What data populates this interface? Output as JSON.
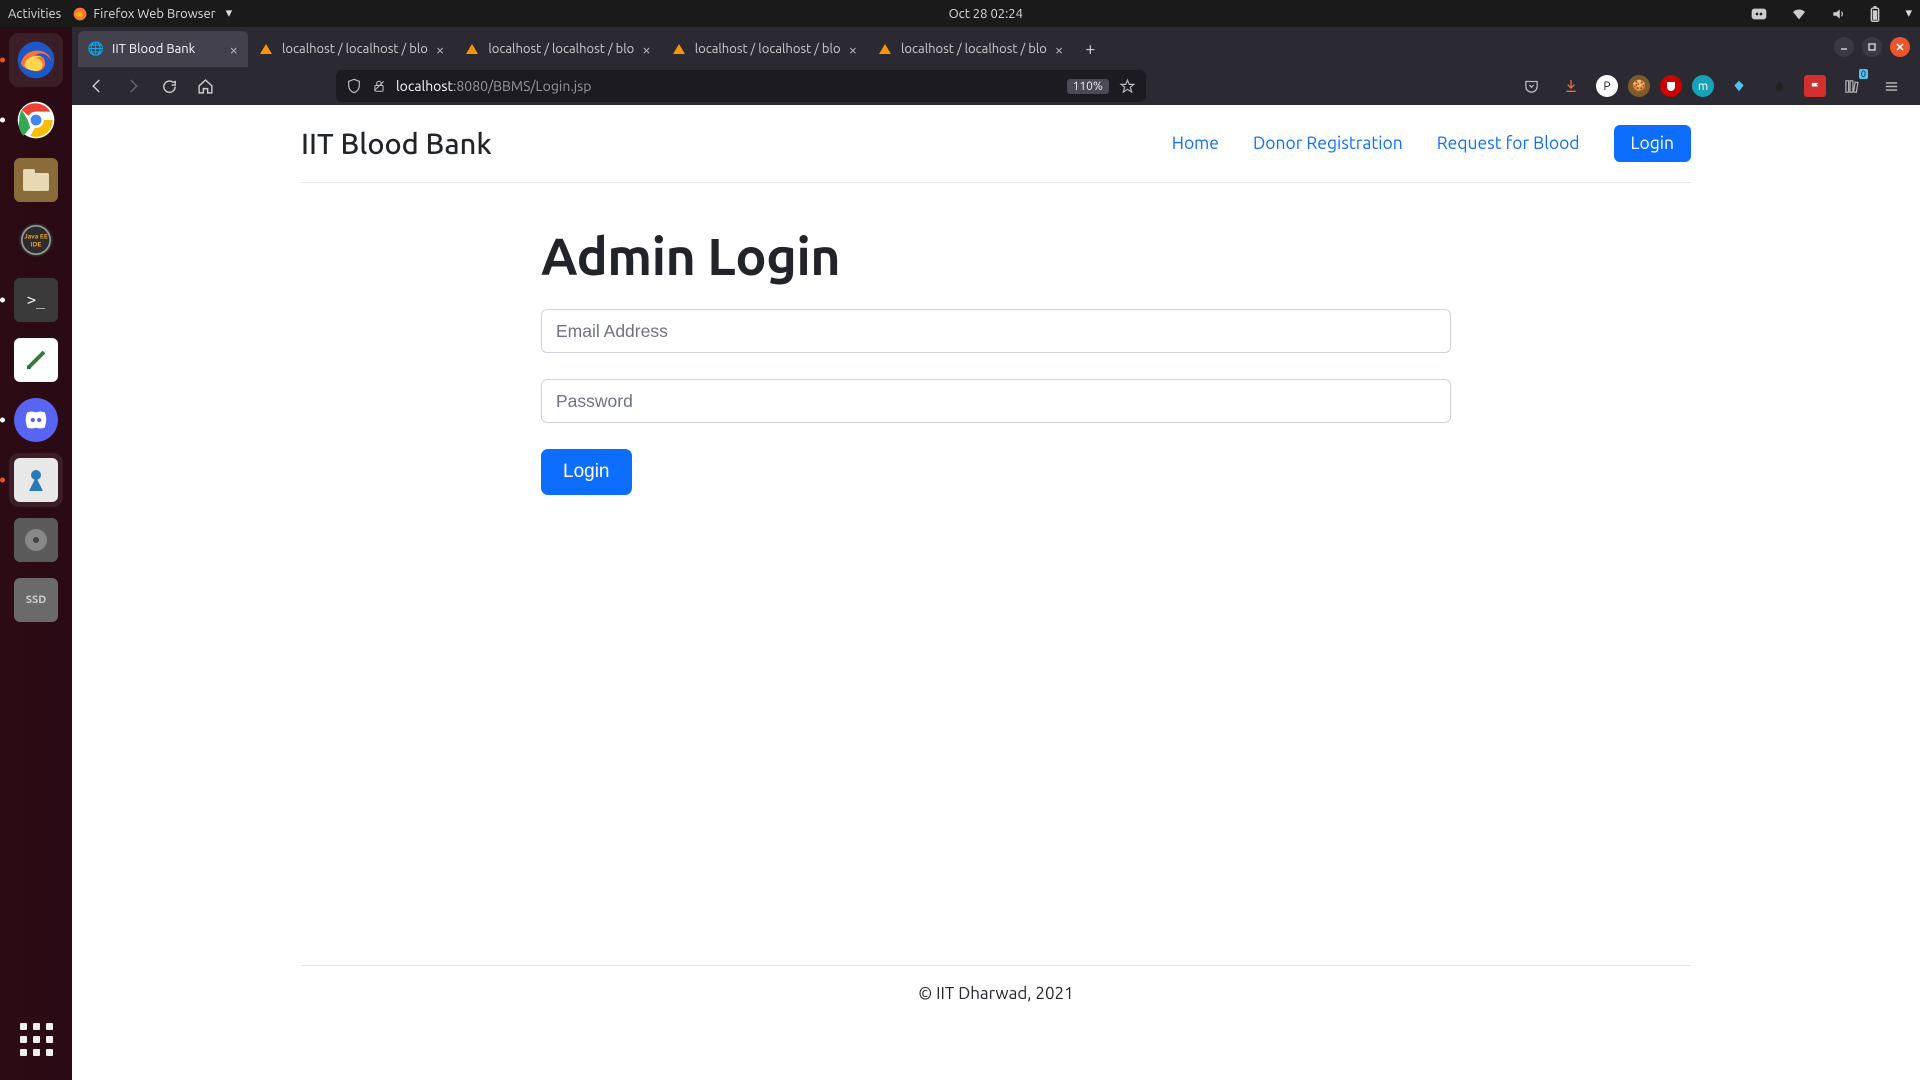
{
  "gnome": {
    "activities": "Activities",
    "app_label": "Firefox Web Browser",
    "clock": "Oct 28  02:24"
  },
  "firefox": {
    "tabs": [
      {
        "title": "IIT Blood Bank",
        "active": true
      },
      {
        "title": "localhost / localhost / blo",
        "active": false
      },
      {
        "title": "localhost / localhost / blo",
        "active": false
      },
      {
        "title": "localhost / localhost / blo",
        "active": false
      },
      {
        "title": "localhost / localhost / blo",
        "active": false
      }
    ],
    "url_host": "localhost",
    "url_rest": ":8080/BBMS/Login.jsp",
    "zoom": "110%"
  },
  "site": {
    "brand": "IIT Blood Bank",
    "nav": {
      "home": "Home",
      "donor": "Donor Registration",
      "request": "Request for Blood",
      "login": "Login"
    },
    "heading": "Admin Login",
    "email_placeholder": "Email Address",
    "password_placeholder": "Password",
    "submit": "Login",
    "footer": "© IIT Dharwad, 2021"
  }
}
